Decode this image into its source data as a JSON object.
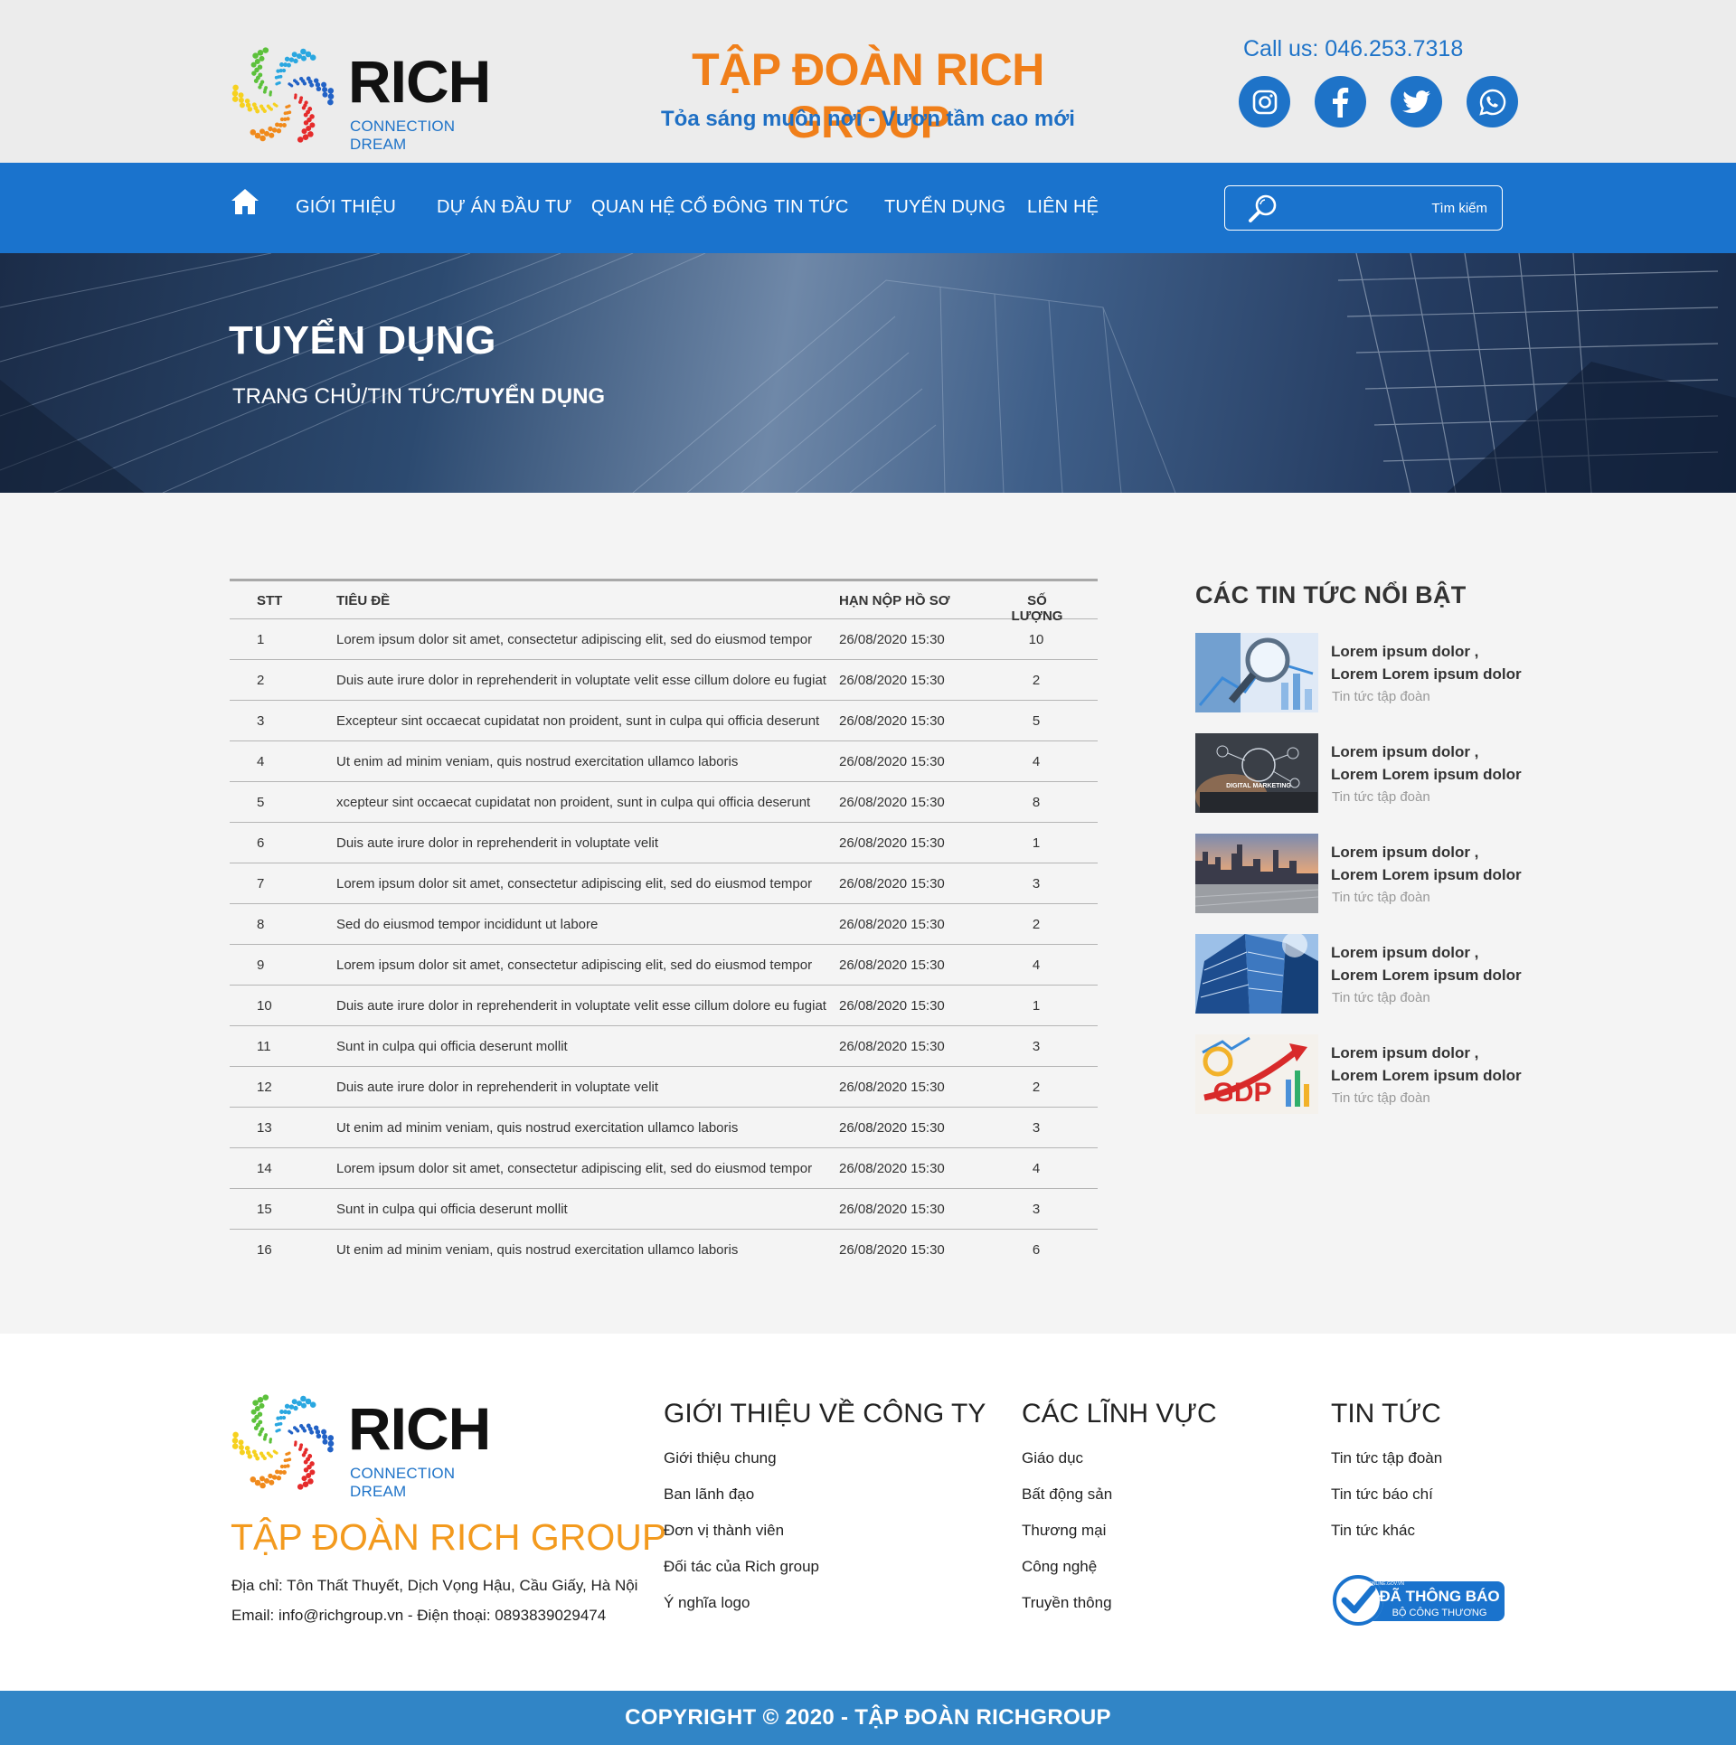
{
  "header": {
    "logo": {
      "word": "RICH",
      "tagline": "CONNECTION DREAM"
    },
    "title": "TẬP ĐOÀN RICH GROUP",
    "slogan": "Tỏa sáng muôn nơi - Vươn tầm cao mới",
    "call": "Call us: 046.253.7318",
    "socials": [
      "instagram-icon",
      "facebook-icon",
      "twitter-icon",
      "whatsapp-icon"
    ]
  },
  "nav": {
    "items": [
      "GIỚI THIỆU",
      "DỰ ÁN ĐẦU TƯ",
      "QUAN HỆ CỔ ĐÔNG",
      "TIN TỨC",
      "TUYỂN DỤNG",
      "LIÊN HỆ"
    ],
    "search_placeholder": "Tìm kiếm"
  },
  "banner": {
    "title": "TUYỂN DỤNG",
    "breadcrumb_prefix": "TRANG CHỦ/TIN TỨC/",
    "breadcrumb_current": "TUYỂN DỤNG"
  },
  "jobs": {
    "headers": {
      "stt": "STT",
      "title": "TIÊU ĐỀ",
      "deadline": "HẠN NỘP HỒ SƠ",
      "qty": "SỐ LƯỢNG"
    },
    "rows": [
      {
        "stt": "1",
        "title": "Lorem ipsum dolor sit amet, consectetur adipiscing elit, sed do eiusmod tempor",
        "deadline": "26/08/2020 15:30",
        "qty": "10"
      },
      {
        "stt": "2",
        "title": "Duis aute irure dolor in reprehenderit in voluptate velit esse cillum dolore eu fugiat",
        "deadline": "26/08/2020 15:30",
        "qty": "2"
      },
      {
        "stt": "3",
        "title": "Excepteur sint occaecat cupidatat non proident, sunt in culpa qui officia deserunt",
        "deadline": "26/08/2020 15:30",
        "qty": "5"
      },
      {
        "stt": "4",
        "title": "Ut enim ad minim veniam, quis nostrud exercitation ullamco laboris",
        "deadline": "26/08/2020 15:30",
        "qty": "4"
      },
      {
        "stt": "5",
        "title": "xcepteur sint occaecat cupidatat non proident, sunt in culpa qui officia deserunt",
        "deadline": "26/08/2020 15:30",
        "qty": "8"
      },
      {
        "stt": "6",
        "title": "Duis aute irure dolor in reprehenderit in voluptate velit",
        "deadline": "26/08/2020 15:30",
        "qty": "1"
      },
      {
        "stt": "7",
        "title": "Lorem ipsum dolor sit amet, consectetur adipiscing elit, sed do eiusmod tempor",
        "deadline": "26/08/2020 15:30",
        "qty": "3"
      },
      {
        "stt": "8",
        "title": "Sed do eiusmod tempor incididunt ut labore",
        "deadline": "26/08/2020 15:30",
        "qty": "2"
      },
      {
        "stt": "9",
        "title": "Lorem ipsum dolor sit amet, consectetur adipiscing elit, sed do eiusmod tempor",
        "deadline": "26/08/2020 15:30",
        "qty": "4"
      },
      {
        "stt": "10",
        "title": "Duis aute irure dolor in reprehenderit in voluptate velit esse cillum dolore eu fugiat",
        "deadline": "26/08/2020 15:30",
        "qty": "1"
      },
      {
        "stt": "11",
        "title": "Sunt in culpa qui officia deserunt mollit",
        "deadline": "26/08/2020 15:30",
        "qty": "3"
      },
      {
        "stt": "12",
        "title": "Duis aute irure dolor in reprehenderit in voluptate velit",
        "deadline": "26/08/2020 15:30",
        "qty": "2"
      },
      {
        "stt": "13",
        "title": "Ut enim ad minim veniam, quis nostrud exercitation ullamco laboris",
        "deadline": "26/08/2020 15:30",
        "qty": "3"
      },
      {
        "stt": "14",
        "title": "Lorem ipsum dolor sit amet, consectetur adipiscing elit, sed do eiusmod tempor",
        "deadline": "26/08/2020 15:30",
        "qty": "4"
      },
      {
        "stt": "15",
        "title": "Sunt in culpa qui officia deserunt mollit",
        "deadline": "26/08/2020 15:30",
        "qty": "3"
      },
      {
        "stt": "16",
        "title": "Ut enim ad minim veniam, quis nostrud exercitation ullamco laboris",
        "deadline": "26/08/2020 15:30",
        "qty": "6"
      }
    ]
  },
  "sidebar": {
    "title": "CÁC TIN TỨC NỔI BẬT",
    "news": [
      {
        "title": "Lorem ipsum dolor , Lorem Lorem ipsum dolor",
        "category": "Tin tức tập đoàn",
        "thumb": "magnifier-photo"
      },
      {
        "title": "Lorem ipsum dolor , Lorem Lorem ipsum dolor",
        "category": "Tin tức tập đoàn",
        "thumb": "digital-marketing-photo",
        "thumb_text": "DIGITAL MARKETING"
      },
      {
        "title": "Lorem ipsum dolor , Lorem Lorem ipsum dolor",
        "category": "Tin tức tập đoàn",
        "thumb": "city-skyline-photo"
      },
      {
        "title": "Lorem ipsum dolor , Lorem Lorem ipsum dolor",
        "category": "Tin tức tập đoàn",
        "thumb": "skyscraper-photo"
      },
      {
        "title": "Lorem ipsum dolor , Lorem Lorem ipsum dolor",
        "category": "Tin tức tập đoàn",
        "thumb": "gdp-chart-photo",
        "thumb_text": "GDP"
      }
    ]
  },
  "footer": {
    "brand": "TẬP ĐOÀN RICH GROUP",
    "address": "Địa chỉ: Tôn Thất Thuyết, Dịch Vọng Hậu, Cầu Giấy, Hà Nội",
    "contact": "Email: info@richgroup.vn - Điện thoại: 0893839029474",
    "columns": [
      {
        "title": "GIỚI THIỆU VỀ CÔNG TY",
        "links": [
          "Giới thiệu chung",
          "Ban lãnh đạo",
          "Đơn vị thành viên",
          "Đối tác của Rich group",
          "Ý nghĩa logo"
        ]
      },
      {
        "title": "CÁC LĨNH VỰC",
        "links": [
          "Giáo dục",
          "Bất động sản",
          "Thương mại",
          "Công nghệ",
          "Truyền thông"
        ]
      },
      {
        "title": "TIN TỨC",
        "links": [
          "Tin tức tập đoàn",
          "Tin tức báo chí",
          "Tin tức khác"
        ]
      }
    ],
    "badge": {
      "line1": "ĐÃ THÔNG BÁO",
      "line2": "BỘ CÔNG THƯƠNG",
      "ring": "ONLINE.GOV.VN"
    },
    "copyright": "COPYRIGHT © 2020 - TẬP ĐOÀN RICHGROUP"
  },
  "colors": {
    "brand_blue": "#1a73cd",
    "brand_orange": "#f07f1a",
    "footer_bar": "#3185c6"
  }
}
